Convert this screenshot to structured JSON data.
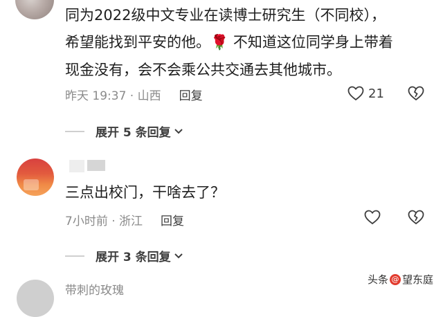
{
  "comments": [
    {
      "lines": [
        "同为2022级中文专业在读博士研究生（不同校），",
        "希望能找到平安的他。🌹 不知道这位同学身上带着",
        "现金没有，会不会乘公共交通去其他城市。"
      ],
      "time_location": "昨天 19:37 · 山西",
      "reply_label": "回复",
      "like_count": "21",
      "expand_label": "展开 5 条回复"
    },
    {
      "text": "三点出校门，干啥去了？",
      "time_location": "7小时前 · 浙江",
      "reply_label": "回复",
      "expand_label": "展开 3 条回复"
    }
  ],
  "partial_username": "带刺的玫瑰",
  "watermark": {
    "prefix": "头条",
    "name": "望东庭"
  },
  "icons": [
    "heart-icon",
    "broken-heart-icon",
    "chevron-down-icon"
  ]
}
